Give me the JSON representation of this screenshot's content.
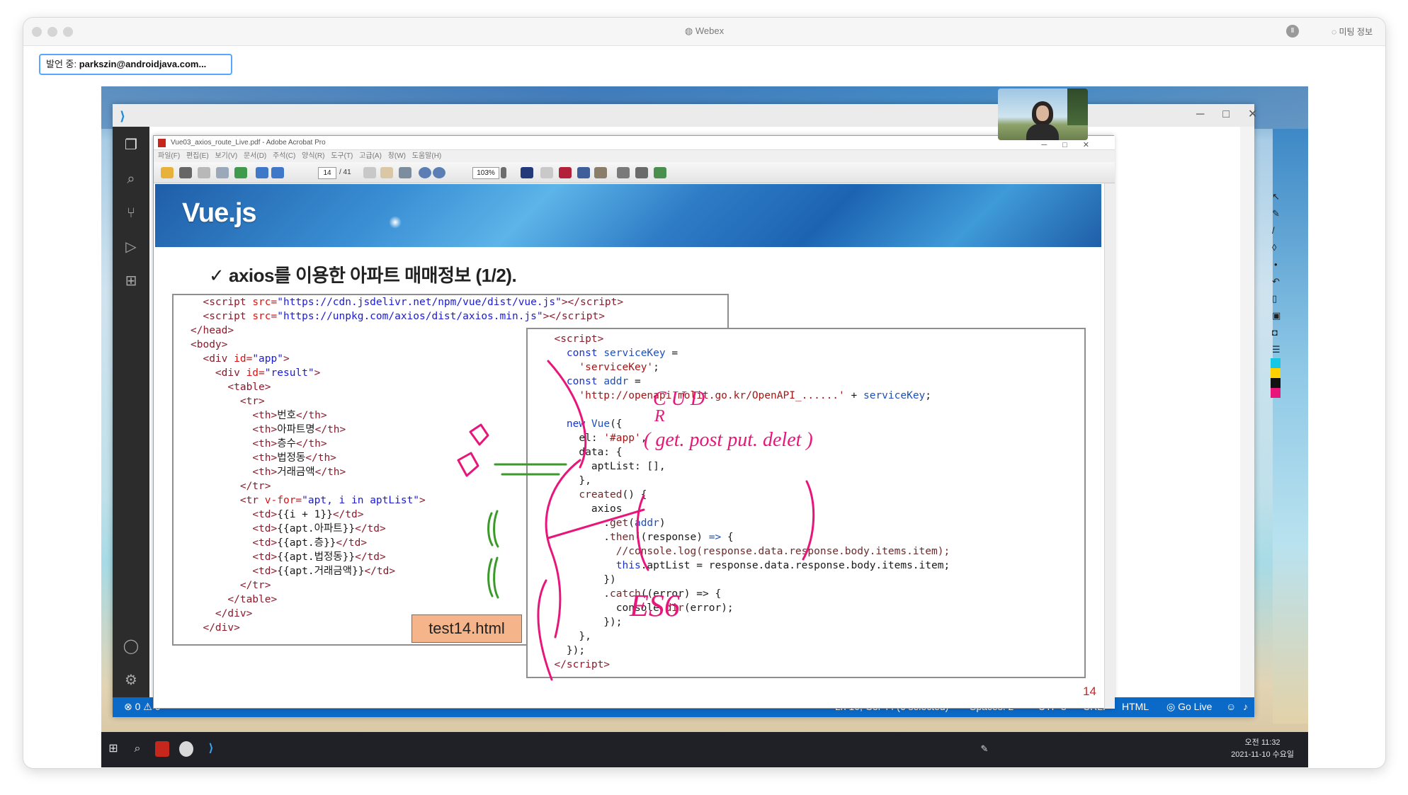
{
  "app": {
    "title": "Webex",
    "meeting_info": "미팅 정보",
    "rec_badge": "Ⅱ"
  },
  "speaker": {
    "label": "발언 중:",
    "email": "parkszin@androidjava.com..."
  },
  "acrobat": {
    "title": "Vue03_axios_route_Live.pdf - Adobe Acrobat Pro",
    "menu": [
      "파일(F)",
      "편집(E)",
      "보기(V)",
      "문서(D)",
      "주석(C)",
      "양식(R)",
      "도구(T)",
      "고급(A)",
      "창(W)",
      "도움말(H)"
    ],
    "page_current": "14",
    "page_total": "/ 41",
    "zoom": "103%"
  },
  "slide": {
    "header_title": "Vue.js",
    "heading": "✓ axios를 이용한 아파트 매매정보 (1/2).",
    "file_label": "test14.html",
    "page_number": "14",
    "annotations": {
      "crud_top": "C   U   D",
      "crud_r": "R",
      "crud_methods": "( get.  post  put.  delet )",
      "es6": "ES6"
    }
  },
  "vscode": {
    "status": {
      "problems": "⊗ 0 ⚠ 0",
      "position": "Ln 10, Col 44 (6 selected)",
      "spaces": "Spaces: 2",
      "encoding": "UTF-8",
      "eol": "CRLF",
      "language": "HTML",
      "golive": "Go Live"
    }
  },
  "taskbar": {
    "time": "오전 11:32",
    "date": "2021-11-10 수요일"
  },
  "colors": {
    "accent": "#0b69c7",
    "pen": "#e8157a",
    "highlight": "#3a9a2a",
    "speaker_border": "#57a6ff"
  }
}
